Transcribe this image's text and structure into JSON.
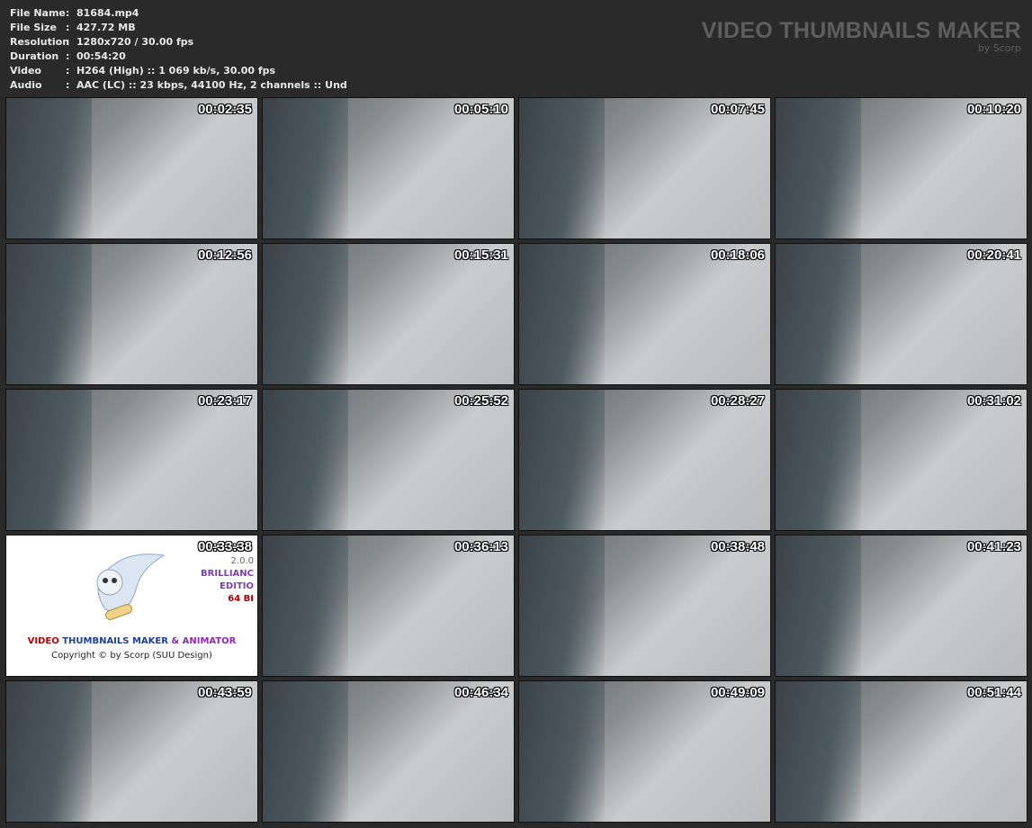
{
  "info": [
    {
      "key": "File Name",
      "value": "81684.mp4"
    },
    {
      "key": "File Size",
      "value": "427.72 MB"
    },
    {
      "key": "Resolution",
      "value": "1280x720 / 30.00 fps"
    },
    {
      "key": "Duration",
      "value": "00:54:20"
    },
    {
      "key": "Video",
      "value": "H264 (High) :: 1 069 kb/s, 30.00 fps"
    },
    {
      "key": "Audio",
      "value": "AAC (LC) :: 23 kbps, 44100 Hz, 2 channels :: Und"
    }
  ],
  "separator": ":",
  "brand": {
    "title": "VIDEO THUMBNAILS MAKER",
    "subtitle": "by Scorp"
  },
  "thumbnails": [
    "00:02:35",
    "00:05:10",
    "00:07:45",
    "00:10:20",
    "00:12:56",
    "00:15:31",
    "00:18:06",
    "00:20:41",
    "00:23:17",
    "00:25:52",
    "00:28:27",
    "00:31:02",
    "00:33:38",
    "00:36:13",
    "00:38:48",
    "00:41:23",
    "00:43:59",
    "00:46:34",
    "00:49:09",
    "00:51:44"
  ],
  "logo_tile": {
    "index": 12,
    "version": "2.0.0",
    "edition_1": "BRILLIANC",
    "edition_2": "EDITIO",
    "bits": "64 BI",
    "title_a": "VIDEO ",
    "title_b": "THUMBNAILS MAKER",
    "title_c": " & ANIMATOR",
    "copyright": "Copyright © by Scorp (SUU Design)"
  }
}
